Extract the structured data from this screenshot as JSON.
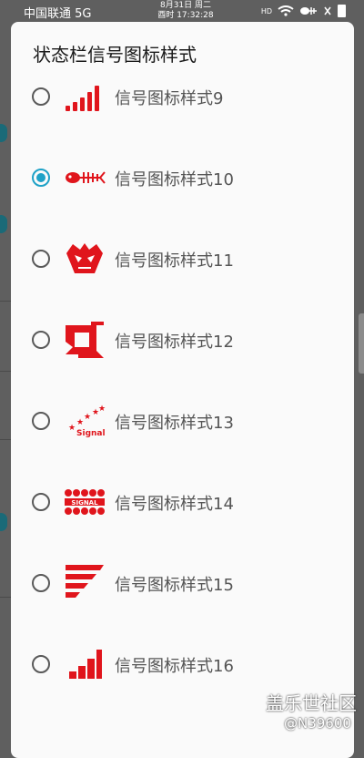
{
  "status_bar": {
    "carrier": "中国联通 5G",
    "date": "8月31日 周二",
    "time": "酉时 17:32:28",
    "hd": "HD"
  },
  "dialog": {
    "title": "状态栏信号图标样式",
    "options": [
      {
        "label": "信号图标样式9",
        "selected": false,
        "icon": "ascending-bars-icon"
      },
      {
        "label": "信号图标样式10",
        "selected": true,
        "icon": "fish-bone-icon"
      },
      {
        "label": "信号图标样式11",
        "selected": false,
        "icon": "skull-icon"
      },
      {
        "label": "信号图标样式12",
        "selected": false,
        "icon": "frame-shuriken-icon"
      },
      {
        "label": "信号图标样式13",
        "selected": false,
        "icon": "star-signal-icon"
      },
      {
        "label": "信号图标样式14",
        "selected": false,
        "icon": "signal-dots-icon"
      },
      {
        "label": "信号图标样式15",
        "selected": false,
        "icon": "stripes-icon"
      },
      {
        "label": "信号图标样式16",
        "selected": false,
        "icon": "step-bars-icon"
      }
    ]
  },
  "icon_text": {
    "star_signal": "Signal",
    "signal_dots": "SIGNAL"
  },
  "watermark": {
    "line1": "盖乐世社区",
    "line2": "@N39600"
  },
  "colors": {
    "accent": "#1fa2c7",
    "icon_red": "#e0151c"
  }
}
